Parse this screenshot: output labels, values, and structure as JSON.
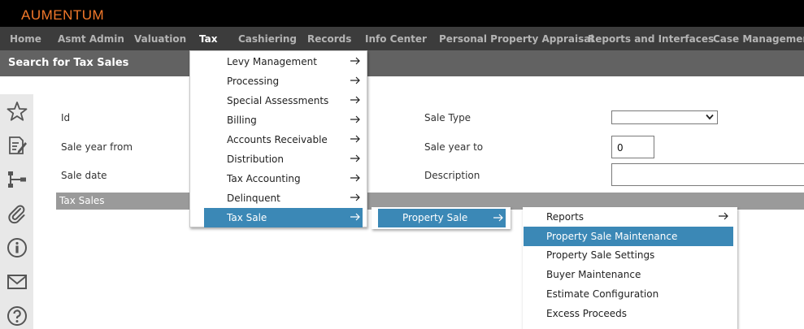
{
  "app": {
    "brand": "AUMENTUM",
    "brand_color": "#f2782a"
  },
  "nav": {
    "items": [
      "Home",
      "Asmt Admin",
      "Valuation",
      "Tax",
      "Cashiering",
      "Records",
      "Info Center",
      "Personal Property Appraisal",
      "Reports and Interfaces",
      "Case Management"
    ],
    "active": "Tax"
  },
  "page": {
    "title": "Search for Tax Sales"
  },
  "sidebar": {
    "icons": [
      "star-icon",
      "notes-icon",
      "hierarchy-icon",
      "paperclip-icon",
      "info-icon",
      "mail-icon",
      "help-icon"
    ]
  },
  "form": {
    "id_label": "Id",
    "sale_year_from_label": "Sale year from",
    "sale_date_label": "Sale date",
    "sale_type_label": "Sale Type",
    "sale_type_value": "",
    "sale_year_to_label": "Sale year to",
    "sale_year_to_value": "0",
    "description_label": "Description",
    "description_value": ""
  },
  "results": {
    "band_label": "Tax Sales"
  },
  "menus": {
    "tax": [
      "Levy Management",
      "Processing",
      "Special Assessments",
      "Billing",
      "Accounts Receivable",
      "Distribution",
      "Tax Accounting",
      "Delinquent",
      "Tax Sale"
    ],
    "tax_sale": [
      "Property Sale"
    ],
    "property_sale": [
      "Reports",
      "Property Sale Maintenance",
      "Property Sale Settings",
      "Buyer Maintenance",
      "Estimate Configuration",
      "Excess Proceeds"
    ],
    "highlight_color": "#3b88b6"
  }
}
